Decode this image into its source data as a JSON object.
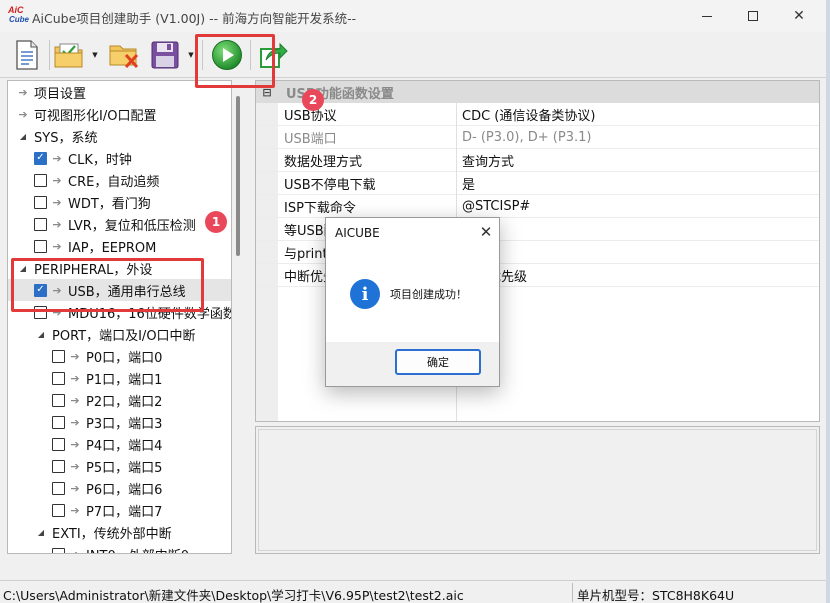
{
  "window": {
    "title": "AiCube项目创建助手 (V1.00J) -- 前海方向智能开发系统--",
    "logo_top": "AiC",
    "logo_bottom": "Cube"
  },
  "toolbar": {
    "icons": [
      "new-file-icon",
      "open-folder-icon",
      "close-folder-icon",
      "save-disk-icon",
      "run-play-icon",
      "export-icon"
    ]
  },
  "tree": {
    "items": [
      {
        "label": "项目设置",
        "level": 0,
        "type": "arrow"
      },
      {
        "label": "可视图形化I/O口配置",
        "level": 0,
        "type": "arrow"
      },
      {
        "label": "SYS，系统",
        "level": 0,
        "type": "expanded"
      },
      {
        "label": "CLK，时钟",
        "level": 1,
        "type": "checkbox",
        "checked": true
      },
      {
        "label": "CRE，自动追频",
        "level": 1,
        "type": "checkbox",
        "checked": false
      },
      {
        "label": "WDT，看门狗",
        "level": 1,
        "type": "checkbox",
        "checked": false
      },
      {
        "label": "LVR，复位和低压检测",
        "level": 1,
        "type": "checkbox",
        "checked": false
      },
      {
        "label": "IAP，EEPROM",
        "level": 1,
        "type": "checkbox",
        "checked": false
      },
      {
        "label": "PERIPHERAL，外设",
        "level": 0,
        "type": "expanded"
      },
      {
        "label": "USB，通用串行总线",
        "level": 1,
        "type": "checkbox",
        "checked": true,
        "selected": true
      },
      {
        "label": "MDU16，16位硬件数学函数",
        "level": 1,
        "type": "checkbox",
        "checked": false
      },
      {
        "label": "PORT，端口及I/O口中断",
        "level": 1,
        "type": "expanded"
      },
      {
        "label": "P0口，端口0",
        "level": 2,
        "type": "checkbox",
        "checked": false
      },
      {
        "label": "P1口，端口1",
        "level": 2,
        "type": "checkbox",
        "checked": false
      },
      {
        "label": "P2口，端口2",
        "level": 2,
        "type": "checkbox",
        "checked": false
      },
      {
        "label": "P3口，端口3",
        "level": 2,
        "type": "checkbox",
        "checked": false
      },
      {
        "label": "P4口，端口4",
        "level": 2,
        "type": "checkbox",
        "checked": false
      },
      {
        "label": "P5口，端口5",
        "level": 2,
        "type": "checkbox",
        "checked": false
      },
      {
        "label": "P6口，端口6",
        "level": 2,
        "type": "checkbox",
        "checked": false
      },
      {
        "label": "P7口，端口7",
        "level": 2,
        "type": "checkbox",
        "checked": false
      },
      {
        "label": "EXTI，传统外部中断",
        "level": 1,
        "type": "expanded"
      },
      {
        "label": "INT0，外部中断0",
        "level": 2,
        "type": "checkbox",
        "checked": false
      }
    ]
  },
  "properties": {
    "section": "USB功能函数设置",
    "rows": [
      {
        "name": "USB协议",
        "value": "CDC (通信设备类协议)",
        "dim": false
      },
      {
        "name": "USB端口",
        "value": "D- (P3.0), D+ (P3.1)",
        "dim": true
      },
      {
        "name": "数据处理方式",
        "value": "查询方式",
        "dim": false
      },
      {
        "name": "USB不停电下载",
        "value": "是",
        "dim": false
      },
      {
        "name": "ISP下载命令",
        "value": "@STCISP#",
        "dim": false
      },
      {
        "name": "等USB配置完成",
        "value": "",
        "dim": false
      },
      {
        "name": "与printf函数",
        "value": "",
        "dim": false
      },
      {
        "name": "中断优先级",
        "value": "最低优先级",
        "dim": false
      }
    ]
  },
  "dialog": {
    "title": "AICUBE",
    "message": "项目创建成功！",
    "ok_label": "确定"
  },
  "status": {
    "path": "C:\\Users\\Administrator\\新建文件夹\\Desktop\\学习打卡\\V6.95P\\test2\\test2.aic",
    "model": "单片机型号：STC8H8K64U"
  },
  "annotations": {
    "badge1": "1",
    "badge2": "2",
    "color": "#e23a3a"
  }
}
